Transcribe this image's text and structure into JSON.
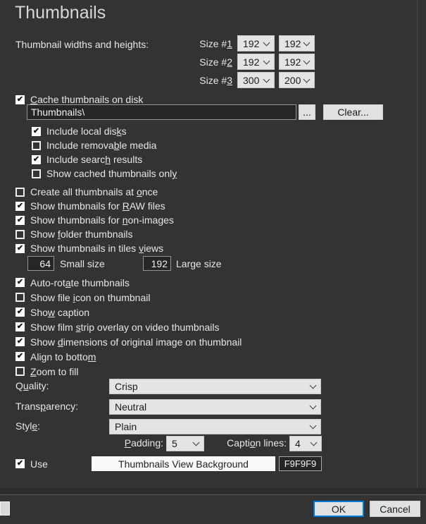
{
  "title": "Thumbnails",
  "colors": {
    "accent": "#0078D7",
    "dialog_background": "#333333"
  },
  "sizes": {
    "heading": "Thumbnail widths and heights:",
    "rows": [
      {
        "text": "Size #1",
        "u": 6,
        "values": [
          "192",
          "192"
        ]
      },
      {
        "text": "Size #2",
        "u": 6,
        "values": [
          "192",
          "192"
        ]
      },
      {
        "text": "Size #3",
        "u": 6,
        "values": [
          "300",
          "200"
        ]
      }
    ]
  },
  "cache": {
    "checkbox": {
      "text": "Cache thumbnails on disk",
      "u": 0,
      "checked": true
    },
    "path_value": "Thumbnails\\",
    "browse_label": "...",
    "clear_label": "Clear...",
    "sub_options": [
      {
        "text": "Include local disks",
        "u": 17,
        "checked": true
      },
      {
        "text": "Include removable media",
        "u": 14,
        "checked": false
      },
      {
        "text": "Include search results",
        "u": 13,
        "checked": true
      },
      {
        "text": "Show cached thumbnails only",
        "u": 26,
        "checked": false
      }
    ]
  },
  "options_top": [
    {
      "text": "Create all thumbnails at once",
      "u": 25,
      "checked": false
    },
    {
      "text": "Show thumbnails for RAW files",
      "u": 20,
      "checked": true
    },
    {
      "text": "Show thumbnails for non-images",
      "u": 20,
      "checked": true
    },
    {
      "text": "Show folder thumbnails",
      "u": 5,
      "checked": false
    },
    {
      "text": "Show thumbnails in tiles views",
      "u": 25,
      "checked": true
    }
  ],
  "tile_sizes": {
    "small": {
      "value": "64",
      "label": "Small size"
    },
    "large": {
      "value": "192",
      "label": "Large size"
    }
  },
  "options_bottom": [
    {
      "text": "Auto-rotate thumbnails",
      "u": 8,
      "checked": true
    },
    {
      "text": "Show file icon on thumbnail",
      "u": 10,
      "checked": false
    },
    {
      "text": "Show caption",
      "u": 3,
      "checked": true
    },
    {
      "text": "Show film strip overlay on video thumbnails",
      "u": 10,
      "checked": true
    },
    {
      "text": "Show dimensions of original image on thumbnail",
      "u": 5,
      "checked": true
    },
    {
      "text": "Align to bottom",
      "u": 14,
      "checked": true
    },
    {
      "text": "Zoom to fill",
      "u": 0,
      "checked": false
    }
  ],
  "selects": [
    {
      "text": "Quality:",
      "u": 1,
      "value": "Crisp"
    },
    {
      "text": "Transparency:",
      "u": 5,
      "value": "Neutral"
    },
    {
      "text": "Style:",
      "u": 4,
      "value": "Plain"
    }
  ],
  "padding_row": {
    "padding": {
      "text": "Padding:",
      "u": 0,
      "value": "5"
    },
    "caption_lines": {
      "text": "Caption lines:",
      "u": 5,
      "value": "4"
    }
  },
  "background_row": {
    "use": {
      "text": "Use",
      "u": -1,
      "checked": true
    },
    "button_label": "Thumbnails View Background",
    "hex_value": "F9F9F9",
    "swatch_color": "#F9F9F9"
  },
  "footer": {
    "ok_label": "OK",
    "cancel_label": "Cancel"
  }
}
